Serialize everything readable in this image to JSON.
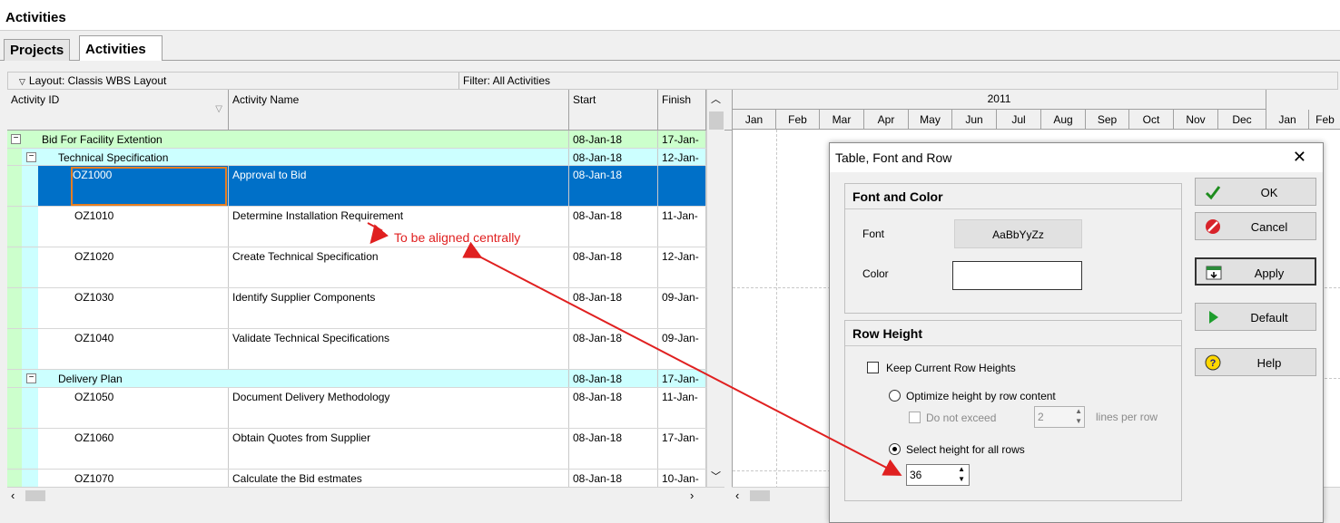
{
  "window": {
    "title": "Activities"
  },
  "tabs": [
    {
      "label": "Projects"
    },
    {
      "label": "Activities"
    }
  ],
  "toolbar": {
    "layout": "Layout: Classis WBS Layout",
    "filter": "Filter: All Activities"
  },
  "columns": {
    "id": "Activity ID",
    "name": "Activity Name",
    "start": "Start",
    "finish": "Finish"
  },
  "rows": [
    {
      "id": "Bid For Facility Extention",
      "start": "08-Jan-18",
      "finish": "17-Jan-"
    },
    {
      "id": "Technical Specification",
      "start": "08-Jan-18",
      "finish": "12-Jan-"
    },
    {
      "id": "OZ1000",
      "name": "Approval to Bid",
      "start": "08-Jan-18",
      "finish": ""
    },
    {
      "id": "OZ1010",
      "name": "Determine Installation Requirement",
      "start": "08-Jan-18",
      "finish": "11-Jan-"
    },
    {
      "id": "OZ1020",
      "name": "Create Technical Specification",
      "start": "08-Jan-18",
      "finish": "12-Jan-"
    },
    {
      "id": "OZ1030",
      "name": "Identify Supplier Components",
      "start": "08-Jan-18",
      "finish": "09-Jan-"
    },
    {
      "id": "OZ1040",
      "name": "Validate Technical Specifications",
      "start": "08-Jan-18",
      "finish": "09-Jan-"
    },
    {
      "id": "Delivery Plan",
      "start": "08-Jan-18",
      "finish": "17-Jan-"
    },
    {
      "id": "OZ1050",
      "name": "Document Delivery Methodology",
      "start": "08-Jan-18",
      "finish": "11-Jan-"
    },
    {
      "id": "OZ1060",
      "name": "Obtain Quotes from Supplier",
      "start": "08-Jan-18",
      "finish": "17-Jan-"
    },
    {
      "id": "OZ1070",
      "name": "Calculate the Bid estmates",
      "start": "08-Jan-18",
      "finish": "10-Jan-"
    }
  ],
  "gantt": {
    "year": "2011",
    "months": [
      "Jan",
      "Feb",
      "Mar",
      "Apr",
      "May",
      "Jun",
      "Jul",
      "Aug",
      "Sep",
      "Oct",
      "Nov",
      "Dec",
      "Jan",
      "Feb"
    ]
  },
  "annotation": {
    "text": "To be aligned centrally"
  },
  "dialog": {
    "title": "Table, Font and Row",
    "font_color_header": "Font and Color",
    "font_label": "Font",
    "font_sample": "AaBbYyZz",
    "color_label": "Color",
    "row_height_header": "Row Height",
    "keep_current": "Keep Current Row Heights",
    "optimize": "Optimize height by row content",
    "do_not_exceed": "Do not exceed",
    "lines_value": "2",
    "lines_per_row": "lines per row",
    "select_height": "Select height for all rows",
    "height_value": "36",
    "buttons": {
      "ok": "OK",
      "cancel": "Cancel",
      "apply": "Apply",
      "default": "Default",
      "help": "Help"
    }
  },
  "colors": {
    "selection": "#0070c8",
    "wbs_level1": "#ccffcc",
    "wbs_level2": "#ccffff",
    "annotation": "#e02020"
  }
}
